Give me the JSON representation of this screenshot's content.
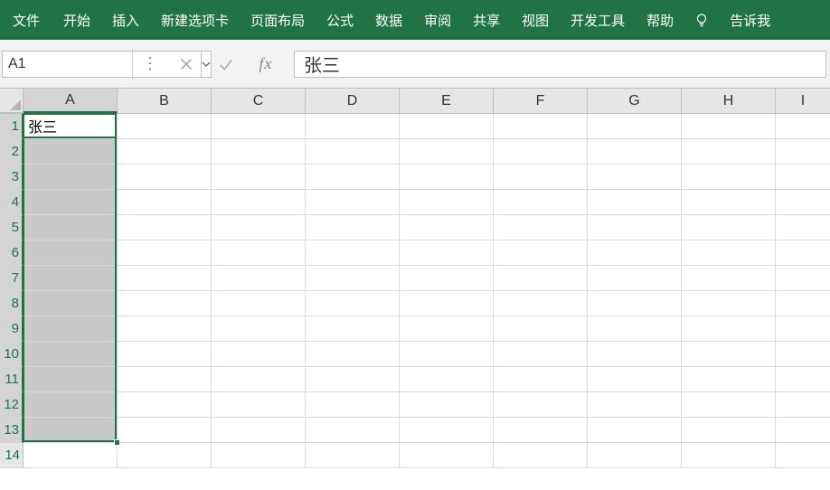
{
  "menu": {
    "items": [
      "文件",
      "开始",
      "插入",
      "新建选项卡",
      "页面布局",
      "公式",
      "数据",
      "审阅",
      "共享",
      "视图",
      "开发工具",
      "帮助"
    ],
    "tell_me": "告诉我"
  },
  "name_box": {
    "value": "A1"
  },
  "formula_bar": {
    "value": "张三"
  },
  "columns": [
    "A",
    "B",
    "C",
    "D",
    "E",
    "F",
    "G",
    "H",
    "I"
  ],
  "rows": [
    "1",
    "2",
    "3",
    "4",
    "5",
    "6",
    "7",
    "8",
    "9",
    "10",
    "11",
    "12",
    "13",
    "14"
  ],
  "cells": {
    "A1": "张三"
  },
  "selection": {
    "range": "A1:A13",
    "active": "A1"
  }
}
